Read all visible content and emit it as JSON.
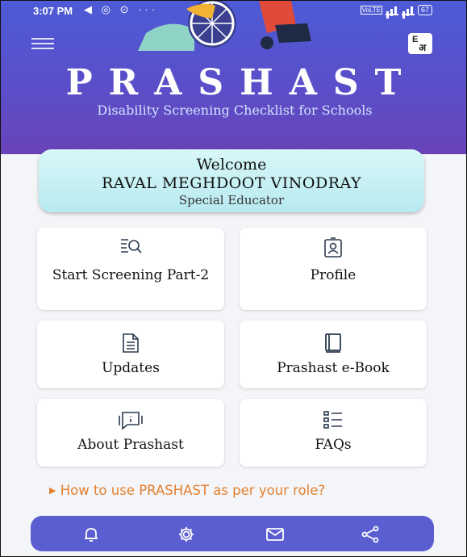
{
  "status_bar": {
    "time": "3:07 PM",
    "left_icons": "◀ ◎ ⊙ ···",
    "right_text": "VoLTE",
    "battery": "67"
  },
  "header": {
    "lang_toggle": {
      "en": "E",
      "hi": "अ"
    },
    "app_title": "PRASHAST",
    "app_subtitle": "Disability Screening Checklist for Schools"
  },
  "welcome": {
    "greeting": "Welcome",
    "name": "RAVAL MEGHDOOT VINODRAY",
    "role": "Special Educator"
  },
  "tiles": [
    {
      "label": "Start Screening Part-2",
      "icon": "search-list-icon"
    },
    {
      "label": "Profile",
      "icon": "profile-card-icon"
    },
    {
      "label": "Updates",
      "icon": "document-icon"
    },
    {
      "label": "Prashast e-Book",
      "icon": "book-icon"
    },
    {
      "label": "About Prashast",
      "icon": "info-chat-icon"
    },
    {
      "label": "FAQs",
      "icon": "checklist-icon"
    }
  ],
  "howto_link": "How to use PRASHAST as per your role?",
  "bottom_nav": [
    {
      "icon": "bell-icon"
    },
    {
      "icon": "gear-icon"
    },
    {
      "icon": "mail-icon"
    },
    {
      "icon": "share-icon"
    }
  ],
  "colors": {
    "header_top": "#4d5bd6",
    "header_bottom": "#6a43b9",
    "welcome_bg": "#c8f0f4",
    "link": "#e3802f",
    "nav_bg": "#5b5ed0",
    "icon_stroke": "#2b3a4f"
  }
}
